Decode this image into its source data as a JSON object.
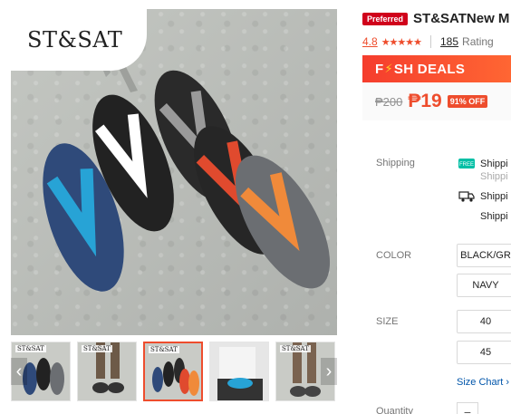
{
  "gallery": {
    "brand_logo": "ST&SAT",
    "nav_prev_icon": "chevron-left-icon",
    "nav_next_icon": "chevron-right-icon",
    "thumbnails": [
      {
        "brand": "ST&SAT",
        "active": false
      },
      {
        "brand": "ST&SAT",
        "active": false
      },
      {
        "brand": "ST&SAT",
        "active": true
      },
      {
        "brand": "",
        "active": false
      },
      {
        "brand": "ST&SAT",
        "active": false
      }
    ],
    "sandal_colors": [
      "#2f4a7a",
      "#222222",
      "#2a2a2a",
      "#262626",
      "#6b6e72"
    ],
    "strap_colors": [
      "#27a3d6",
      "#ffffff",
      "#9a9a9a",
      "#e04a2e",
      "#f08a3a"
    ]
  },
  "product": {
    "badge": "Preferred",
    "title": "ST&SATNew M",
    "rating_value": "4.8",
    "stars": "★★★★★",
    "rating_count": "185",
    "rating_label": "Rating",
    "flash_prefix": "F",
    "flash_bolt": "⚡",
    "flash_suffix": "SH DEALS",
    "old_price": "₱200",
    "new_price": "₱19",
    "discount": "91% OFF"
  },
  "shipping": {
    "label": "Shipping",
    "line1": "Shippi",
    "line1_sub": "Shippi",
    "line2": "Shippi",
    "line2_sub": "Shippi",
    "free_icon": "free-shipping-icon",
    "truck_icon": "truck-icon"
  },
  "color": {
    "label": "COLOR",
    "options": [
      "BLACK/GR",
      "NAVY"
    ]
  },
  "size": {
    "label": "SIZE",
    "options": [
      "40",
      "45"
    ],
    "chart_label": "Size Chart",
    "chart_icon": "chevron-right-icon"
  },
  "quantity": {
    "label": "Quantity",
    "minus": "−"
  },
  "colors": {
    "accent": "#ee4d2d",
    "preferred": "#d0011b",
    "link": "#0055aa"
  }
}
